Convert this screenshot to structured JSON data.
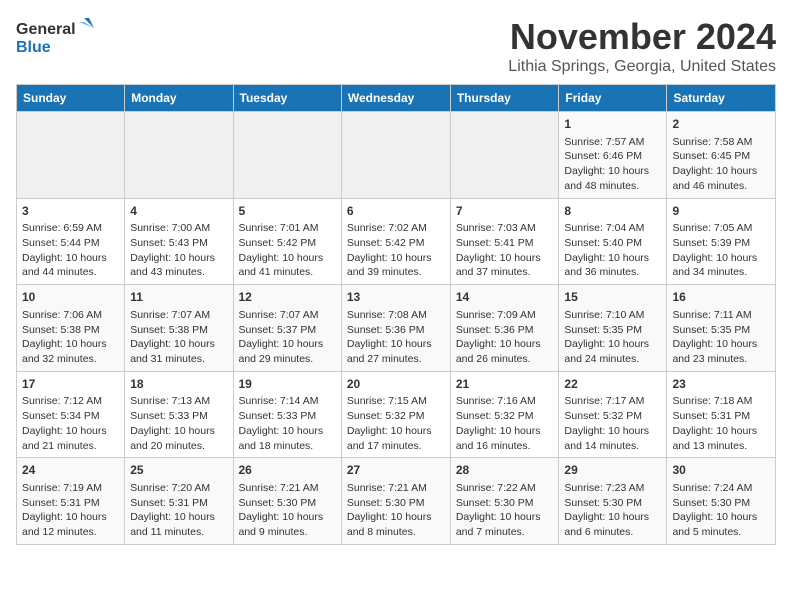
{
  "logo": {
    "line1": "General",
    "line2": "Blue"
  },
  "title": "November 2024",
  "location": "Lithia Springs, Georgia, United States",
  "weekdays": [
    "Sunday",
    "Monday",
    "Tuesday",
    "Wednesday",
    "Thursday",
    "Friday",
    "Saturday"
  ],
  "rows": [
    [
      {
        "day": "",
        "info": ""
      },
      {
        "day": "",
        "info": ""
      },
      {
        "day": "",
        "info": ""
      },
      {
        "day": "",
        "info": ""
      },
      {
        "day": "",
        "info": ""
      },
      {
        "day": "1",
        "info": "Sunrise: 7:57 AM\nSunset: 6:46 PM\nDaylight: 10 hours\nand 48 minutes."
      },
      {
        "day": "2",
        "info": "Sunrise: 7:58 AM\nSunset: 6:45 PM\nDaylight: 10 hours\nand 46 minutes."
      }
    ],
    [
      {
        "day": "3",
        "info": "Sunrise: 6:59 AM\nSunset: 5:44 PM\nDaylight: 10 hours\nand 44 minutes."
      },
      {
        "day": "4",
        "info": "Sunrise: 7:00 AM\nSunset: 5:43 PM\nDaylight: 10 hours\nand 43 minutes."
      },
      {
        "day": "5",
        "info": "Sunrise: 7:01 AM\nSunset: 5:42 PM\nDaylight: 10 hours\nand 41 minutes."
      },
      {
        "day": "6",
        "info": "Sunrise: 7:02 AM\nSunset: 5:42 PM\nDaylight: 10 hours\nand 39 minutes."
      },
      {
        "day": "7",
        "info": "Sunrise: 7:03 AM\nSunset: 5:41 PM\nDaylight: 10 hours\nand 37 minutes."
      },
      {
        "day": "8",
        "info": "Sunrise: 7:04 AM\nSunset: 5:40 PM\nDaylight: 10 hours\nand 36 minutes."
      },
      {
        "day": "9",
        "info": "Sunrise: 7:05 AM\nSunset: 5:39 PM\nDaylight: 10 hours\nand 34 minutes."
      }
    ],
    [
      {
        "day": "10",
        "info": "Sunrise: 7:06 AM\nSunset: 5:38 PM\nDaylight: 10 hours\nand 32 minutes."
      },
      {
        "day": "11",
        "info": "Sunrise: 7:07 AM\nSunset: 5:38 PM\nDaylight: 10 hours\nand 31 minutes."
      },
      {
        "day": "12",
        "info": "Sunrise: 7:07 AM\nSunset: 5:37 PM\nDaylight: 10 hours\nand 29 minutes."
      },
      {
        "day": "13",
        "info": "Sunrise: 7:08 AM\nSunset: 5:36 PM\nDaylight: 10 hours\nand 27 minutes."
      },
      {
        "day": "14",
        "info": "Sunrise: 7:09 AM\nSunset: 5:36 PM\nDaylight: 10 hours\nand 26 minutes."
      },
      {
        "day": "15",
        "info": "Sunrise: 7:10 AM\nSunset: 5:35 PM\nDaylight: 10 hours\nand 24 minutes."
      },
      {
        "day": "16",
        "info": "Sunrise: 7:11 AM\nSunset: 5:35 PM\nDaylight: 10 hours\nand 23 minutes."
      }
    ],
    [
      {
        "day": "17",
        "info": "Sunrise: 7:12 AM\nSunset: 5:34 PM\nDaylight: 10 hours\nand 21 minutes."
      },
      {
        "day": "18",
        "info": "Sunrise: 7:13 AM\nSunset: 5:33 PM\nDaylight: 10 hours\nand 20 minutes."
      },
      {
        "day": "19",
        "info": "Sunrise: 7:14 AM\nSunset: 5:33 PM\nDaylight: 10 hours\nand 18 minutes."
      },
      {
        "day": "20",
        "info": "Sunrise: 7:15 AM\nSunset: 5:32 PM\nDaylight: 10 hours\nand 17 minutes."
      },
      {
        "day": "21",
        "info": "Sunrise: 7:16 AM\nSunset: 5:32 PM\nDaylight: 10 hours\nand 16 minutes."
      },
      {
        "day": "22",
        "info": "Sunrise: 7:17 AM\nSunset: 5:32 PM\nDaylight: 10 hours\nand 14 minutes."
      },
      {
        "day": "23",
        "info": "Sunrise: 7:18 AM\nSunset: 5:31 PM\nDaylight: 10 hours\nand 13 minutes."
      }
    ],
    [
      {
        "day": "24",
        "info": "Sunrise: 7:19 AM\nSunset: 5:31 PM\nDaylight: 10 hours\nand 12 minutes."
      },
      {
        "day": "25",
        "info": "Sunrise: 7:20 AM\nSunset: 5:31 PM\nDaylight: 10 hours\nand 11 minutes."
      },
      {
        "day": "26",
        "info": "Sunrise: 7:21 AM\nSunset: 5:30 PM\nDaylight: 10 hours\nand 9 minutes."
      },
      {
        "day": "27",
        "info": "Sunrise: 7:21 AM\nSunset: 5:30 PM\nDaylight: 10 hours\nand 8 minutes."
      },
      {
        "day": "28",
        "info": "Sunrise: 7:22 AM\nSunset: 5:30 PM\nDaylight: 10 hours\nand 7 minutes."
      },
      {
        "day": "29",
        "info": "Sunrise: 7:23 AM\nSunset: 5:30 PM\nDaylight: 10 hours\nand 6 minutes."
      },
      {
        "day": "30",
        "info": "Sunrise: 7:24 AM\nSunset: 5:30 PM\nDaylight: 10 hours\nand 5 minutes."
      }
    ]
  ]
}
